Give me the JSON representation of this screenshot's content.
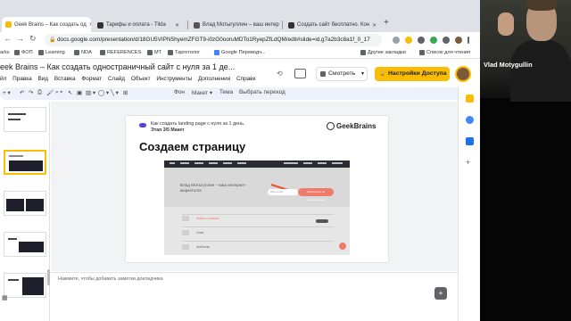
{
  "browser": {
    "tabs": [
      {
        "label": "Geek Brains – Как создать од",
        "color": "#fbbc04",
        "active": true
      },
      {
        "label": "Тарифы и оплата - Tilda",
        "color": "#333333",
        "active": false
      },
      {
        "label": "Влад Мотыгуллин – ваш интер",
        "color": "#555555",
        "active": false
      },
      {
        "label": "Создать сайт бесплатно. Кон",
        "color": "#333333",
        "active": false
      }
    ],
    "new_tab": "+",
    "address": "docs.google.com/presentation/d/18GU5VIPN5hyemZFGT9-i0zG0ooruMDTo1RyepZfLdQM/edit#slide=id.g7a2b3c8a1f_0_17",
    "back": "←",
    "forward": "→",
    "reload": "↻"
  },
  "bookmarks": [
    {
      "label": "arks",
      "color": "#4285f4"
    },
    {
      "label": "ФОП",
      "color": "#5f6368"
    },
    {
      "label": "Learning",
      "color": "#5f6368"
    },
    {
      "label": "NDA",
      "color": "#5f6368"
    },
    {
      "label": "REFERENCES",
      "color": "#5f6368"
    },
    {
      "label": "MT",
      "color": "#5f6368"
    },
    {
      "label": "Таргетолог",
      "color": "#5f6368"
    },
    {
      "label": "Google Переводч...",
      "color": "#4285f4"
    },
    {
      "label": "Другие закладки",
      "color": "#5f6368"
    },
    {
      "label": "Список для чтения",
      "color": "#5f6368"
    }
  ],
  "docs": {
    "title": "eek Brains – Как создать одностраничный сайт с нуля за 1 де...",
    "menu": [
      "йл",
      "Правка",
      "Вид",
      "Вставка",
      "Формат",
      "Слайд",
      "Объект",
      "Инструменты",
      "Дополнения",
      "Справк"
    ],
    "view_button": "Смотреть",
    "share_button": "Настройки Доступа"
  },
  "toolbar": {
    "bg": "Фон",
    "layout": "Макет ▾",
    "theme": "Тема",
    "transition": "Выбрать переход"
  },
  "slide": {
    "subtitle": "Как создать landing page с нуля за 1 день.",
    "stage": "Этап 3/5 Макет",
    "logo": "GeekBrains",
    "title": "Создаем страницу",
    "embed": {
      "hero_text": "Влад Мотыгуллин – ваш интернет-\nмаркетолог",
      "field_placeholder": "Мой email",
      "cta": "Записаться на консультацию",
      "rows": [
        "Кейсы и отзывы",
        "Семь",
        "Шаблоны"
      ]
    }
  },
  "notes": {
    "placeholder": "Нажмите, чтобы добавить заметки докладчика"
  },
  "webcam": {
    "name": "Vlad Motygullin"
  },
  "colors": {
    "accent": "#fbbc04",
    "cta": "#ef7b6a",
    "gb_purple": "#5a3fd6"
  }
}
